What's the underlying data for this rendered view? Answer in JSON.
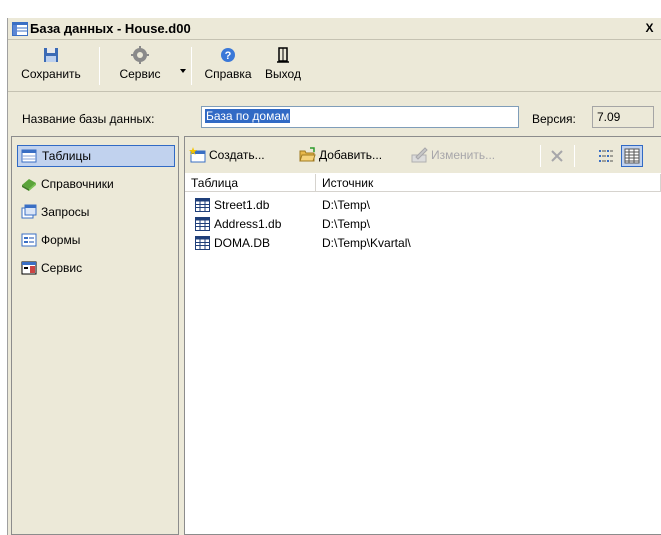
{
  "window": {
    "title": "База данных - House.d00",
    "close_label": "X"
  },
  "toolbar": {
    "save_label": "Сохранить",
    "service_label": "Сервис",
    "help_label": "Справка",
    "exit_label": "Выход"
  },
  "db": {
    "name_label": "Название базы данных:",
    "name_value": "База по домам",
    "version_label": "Версия:",
    "version_value": "7.09"
  },
  "sidebar": {
    "items": [
      {
        "label": "Таблицы",
        "icon": "table-icon",
        "active": true
      },
      {
        "label": "Справочники",
        "icon": "book-icon",
        "active": false
      },
      {
        "label": "Запросы",
        "icon": "query-icon",
        "active": false
      },
      {
        "label": "Формы",
        "icon": "form-icon",
        "active": false
      },
      {
        "label": "Сервис",
        "icon": "service-icon",
        "active": false
      }
    ]
  },
  "actions": {
    "create_label": "Создать...",
    "add_label": "Добавить...",
    "edit_label": "Изменить..."
  },
  "table": {
    "columns": [
      "Таблица",
      "Источник"
    ],
    "rows": [
      {
        "name": "Street1.db",
        "source": "D:\\Temp\\"
      },
      {
        "name": "Address1.db",
        "source": "D:\\Temp\\"
      },
      {
        "name": "DOMA.DB",
        "source": "D:\\Temp\\Kvartal\\"
      }
    ]
  },
  "colors": {
    "selection": "#316ac5",
    "active_bg": "#c1d2ee",
    "window_bg": "#ece9d8"
  }
}
